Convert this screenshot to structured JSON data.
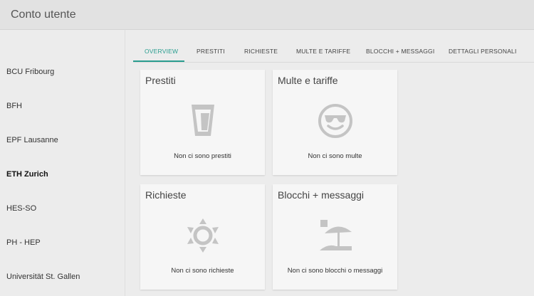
{
  "header": {
    "title": "Conto utente"
  },
  "sidebar": {
    "items": [
      {
        "label": "BCU Fribourg",
        "active": false
      },
      {
        "label": "BFH",
        "active": false
      },
      {
        "label": "EPF Lausanne",
        "active": false
      },
      {
        "label": "ETH Zurich",
        "active": true
      },
      {
        "label": "HES-SO",
        "active": false
      },
      {
        "label": "PH - HEP",
        "active": false
      },
      {
        "label": "Universität St. Gallen",
        "active": false
      }
    ]
  },
  "tabs": [
    {
      "label": "OVERVIEW",
      "active": true
    },
    {
      "label": "PRESTITI",
      "active": false
    },
    {
      "label": "RICHIESTE",
      "active": false
    },
    {
      "label": "MULTE E TARIFFE",
      "active": false
    },
    {
      "label": "BLOCCHI + MESSAGGI",
      "active": false
    },
    {
      "label": "DETTAGLI PERSONALI",
      "active": false
    }
  ],
  "cards": [
    {
      "title": "Prestiti",
      "text": "Non ci sono prestiti",
      "icon": "glass-icon"
    },
    {
      "title": "Multe e tariffe",
      "text": "Non ci sono multe",
      "icon": "cool-face-icon"
    },
    {
      "title": "Richieste",
      "text": "Non ci sono richieste",
      "icon": "sun-icon"
    },
    {
      "title": "Blocchi + messaggi",
      "text": "Non ci sono blocchi o messaggi",
      "icon": "beach-umbrella-icon"
    }
  ],
  "colors": {
    "accent": "#2a9d8f",
    "icon": "#c4c4c4",
    "card_bg": "#f6f6f6",
    "page_bg": "#ececec"
  }
}
